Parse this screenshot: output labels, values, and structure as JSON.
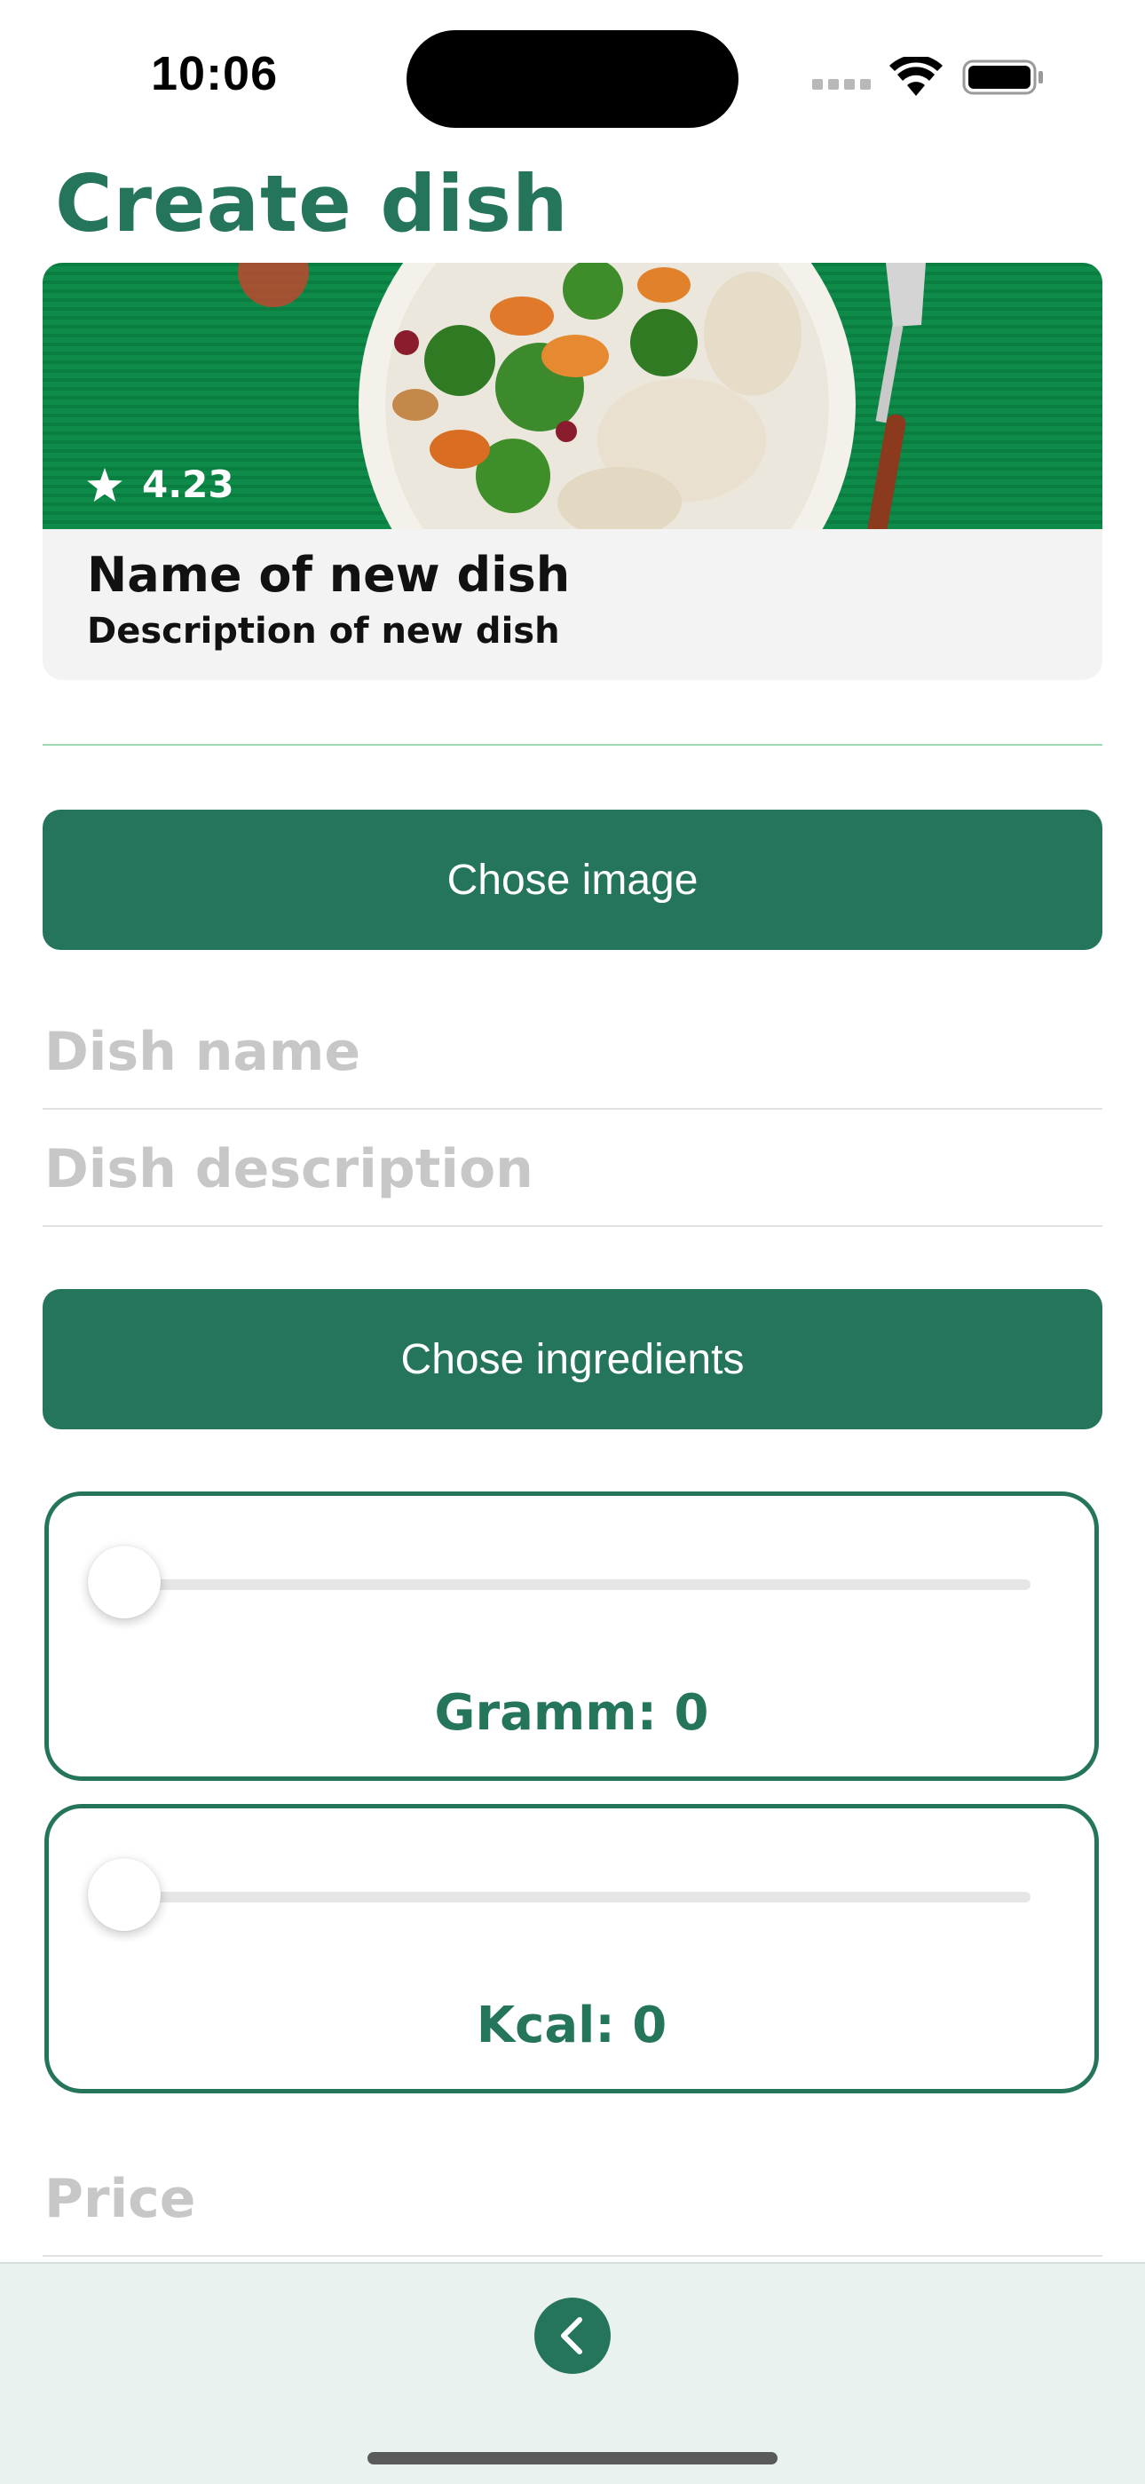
{
  "status_bar": {
    "time": "10:06"
  },
  "header": {
    "title": "Create dish"
  },
  "preview_card": {
    "rating": "4.23",
    "name": "Name of new dish",
    "description": "Description of new dish"
  },
  "buttons": {
    "choose_image": "Chose image",
    "choose_ingredients": "Chose ingredients"
  },
  "fields": {
    "dish_name_placeholder": "Dish name",
    "dish_description_placeholder": "Dish description",
    "price_placeholder": "Price"
  },
  "sliders": [
    {
      "label": "Gramm: 0",
      "value": 0
    },
    {
      "label": "Kcal: 0",
      "value": 0
    }
  ],
  "colors": {
    "accent": "#24755c",
    "placeholder": "#c7c7c7",
    "divider": "#9fd8b3"
  },
  "icons": [
    "wifi-icon",
    "battery-icon",
    "star-icon",
    "back-chevron-icon"
  ]
}
